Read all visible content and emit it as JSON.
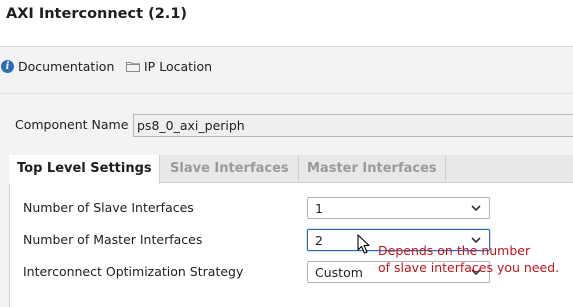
{
  "window": {
    "title": "AXI Interconnect (2.1)"
  },
  "toolbar": {
    "documentation": {
      "icon": "info-icon",
      "label": "Documentation"
    },
    "ip_location": {
      "icon": "folder-icon",
      "label": "IP Location"
    }
  },
  "component": {
    "label": "Component Name",
    "value": "ps8_0_axi_periph"
  },
  "tabs": [
    {
      "label": "Top Level Settings",
      "active": true
    },
    {
      "label": "Slave Interfaces",
      "active": false
    },
    {
      "label": "Master Interfaces",
      "active": false
    }
  ],
  "settings": [
    {
      "label": "Number of Slave Interfaces",
      "value": "1"
    },
    {
      "label": "Number of Master Interfaces",
      "value": "2"
    },
    {
      "label": "Interconnect Optimization Strategy",
      "value": "Custom"
    }
  ],
  "annotation": {
    "line1": "Depends on the number",
    "line2": "of slave interfaces you need.",
    "color": "#c0141b"
  },
  "colors": {
    "accent": "#2d6cb5"
  }
}
